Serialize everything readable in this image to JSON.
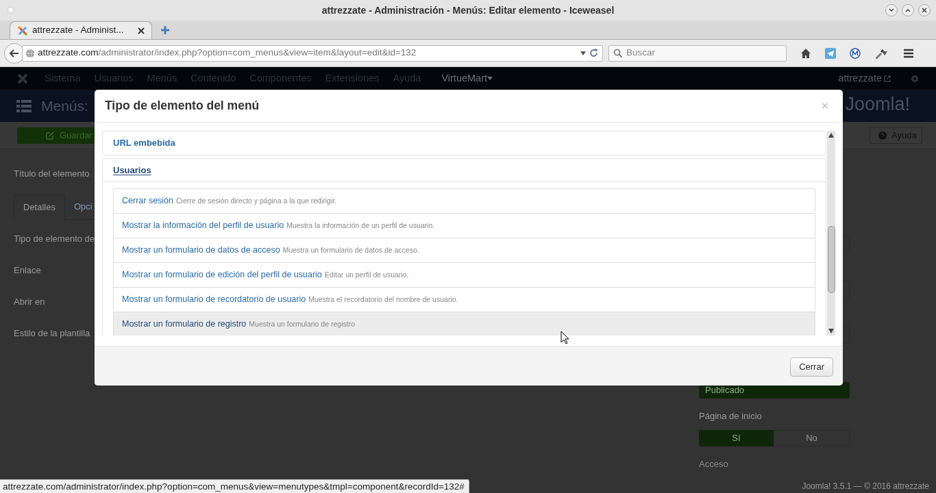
{
  "window": {
    "title": "attrezzate - Administración - Menús: Editar elemento - Iceweasel"
  },
  "tabs": [
    {
      "label": "attrezzate - Administ...",
      "selected": true
    }
  ],
  "address_bar": {
    "host": "attrezzate.com",
    "path": "/administrator/index.php?option=com_menus&view=item&layout=edit&id=132"
  },
  "search": {
    "placeholder": "Buscar"
  },
  "admin_nav": {
    "items": [
      "Sistema",
      "Usuarios",
      "Menús",
      "Contenido",
      "Componentes",
      "Extensiones",
      "Ayuda"
    ],
    "extra_menu": "VirtueMart",
    "user": "attrezzate"
  },
  "page_header": {
    "title": "Menús:",
    "brand": "Joomla!"
  },
  "toolbar": {
    "save": "Guardar",
    "help": "Ayuda"
  },
  "form": {
    "title_label": "Título del elemento",
    "tabs": [
      {
        "label": "Detalles",
        "selected": true
      },
      {
        "label": "Opci",
        "selected": false
      }
    ],
    "labels": [
      "Tipo de elemento de",
      "Enlace",
      "Abrir en",
      "Estilo de la plantilla"
    ]
  },
  "sidebar": {
    "status": "Publicado",
    "home_label": "Página de inicio",
    "home_options": [
      {
        "label": "Sí",
        "selected": true
      },
      {
        "label": "No",
        "selected": false
      }
    ],
    "access_label": "Acceso"
  },
  "footer": "Joomla! 3.5.1  —  © 2016 attrezzate",
  "modal": {
    "title": "Tipo de elemento del menú",
    "close": "×",
    "groups": [
      {
        "label": "URL embebida",
        "expanded": false
      },
      {
        "label": "Usuarios",
        "expanded": true,
        "items": [
          {
            "title": "Cerrar sesión",
            "description": "Cierre de sesión directo y página a la que redirigir.",
            "highlighted": false
          },
          {
            "title": "Mostrar la información del perfil de usuario",
            "description": "Muestra la información de un perfil de usuario.",
            "highlighted": false
          },
          {
            "title": "Mostrar un formulario de datos de acceso",
            "description": "Muestra un formulario de datos de acceso.",
            "highlighted": false
          },
          {
            "title": "Mostrar un formulario de edición del perfil de usuario",
            "description": "Editar un perfil de usuario.",
            "highlighted": false
          },
          {
            "title": "Mostrar un formulario de recordatorio de usuario",
            "description": "Muestra el recordatorio del nombre de usuario.",
            "highlighted": false
          },
          {
            "title": "Mostrar un formulario de registro",
            "description": "Muestra un formulario de registro",
            "highlighted": true
          }
        ]
      }
    ],
    "close_button": "Cerrar"
  },
  "status_url": "attrezzate.com/administrator/index.php?option=com_menus&view=menutypes&tmpl=component&recordId=132#"
}
